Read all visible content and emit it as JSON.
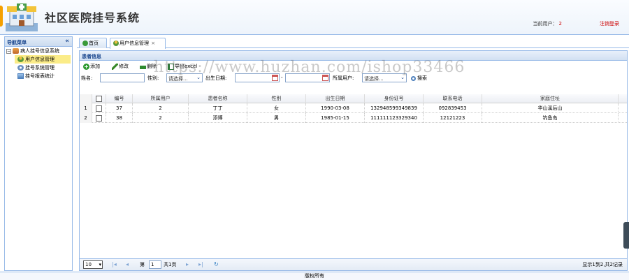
{
  "header": {
    "title": "社区医院挂号系统",
    "current_user_label": "当前用户：",
    "current_user_value": "2",
    "logout_label": "注销登录"
  },
  "sidebar": {
    "title": "导航菜单",
    "root": {
      "label": "病人挂号信息系统",
      "icon": "database-icon"
    },
    "items": [
      {
        "label": "用户信息管理",
        "icon": "user-icon",
        "selected": true
      },
      {
        "label": "挂号系统管理",
        "icon": "gear-icon",
        "selected": false
      },
      {
        "label": "挂号报表统计",
        "icon": "report-icon",
        "selected": false
      }
    ]
  },
  "tabs": [
    {
      "label": "首页",
      "icon": "home-icon",
      "active": false
    },
    {
      "label": "用户信息管理",
      "icon": "user-icon",
      "active": true,
      "close": "×"
    }
  ],
  "panel": {
    "title": "患者信息",
    "toolbar": {
      "add_label": "添加",
      "edit_label": "修改",
      "delete_label": "删除",
      "export_label": "导出excel"
    },
    "search": {
      "name_label": "姓名:",
      "gender_label": "性别:",
      "gender_value": "请选择...",
      "birth_label": "出生日期:",
      "range_sep": "-",
      "owner_label": "所属用户:",
      "owner_value": "请选择...",
      "search_label": "搜索"
    }
  },
  "grid": {
    "columns": [
      "编号",
      "所属用户",
      "患者名称",
      "性别",
      "出生日期",
      "身份证号",
      "联系电话",
      "家庭住址"
    ],
    "rows": [
      {
        "rownum": "1",
        "id": "37",
        "owner": "2",
        "name": "丁丁",
        "gender": "女",
        "birth": "1990-03-08",
        "idcard": "132948599349839",
        "phone": "092839453",
        "address": "华山溪后山"
      },
      {
        "rownum": "2",
        "id": "38",
        "owner": "2",
        "name": "添博",
        "gender": "男",
        "birth": "1985-01-15",
        "idcard": "111111123329340",
        "phone": "12121223",
        "address": "钓鱼岛"
      }
    ]
  },
  "pager": {
    "page_size": "10",
    "page_prefix": "第",
    "page_value": "1",
    "page_total": "共1页",
    "summary": "显示1到2,共2记录"
  },
  "footer": {
    "text": "版权所有"
  },
  "watermark": "https://www.huzhan.com/ishop33466",
  "colors": {
    "border": "#99bbe8",
    "title": "#15428b",
    "selected": "#fbec88",
    "accent": "#cc0000"
  }
}
